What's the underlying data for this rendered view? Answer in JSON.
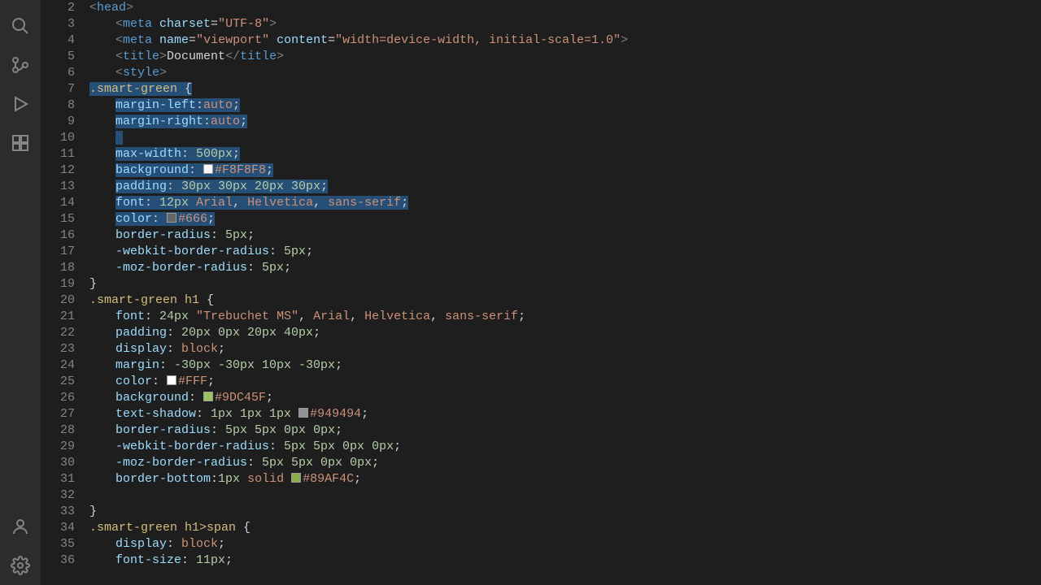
{
  "activity_icons": [
    "search",
    "source-control",
    "run-debug",
    "extensions",
    "account",
    "settings"
  ],
  "first_line_number": 2,
  "code_lines": [
    {
      "n": 2,
      "segs": [
        {
          "t": "<",
          "c": "c-angle"
        },
        {
          "t": "head",
          "c": "c-tag"
        },
        {
          "t": ">",
          "c": "c-angle"
        }
      ],
      "indent": 0
    },
    {
      "n": 3,
      "segs": [
        {
          "t": "<",
          "c": "c-angle"
        },
        {
          "t": "meta ",
          "c": "c-tag"
        },
        {
          "t": "charset",
          "c": "c-attr"
        },
        {
          "t": "=",
          "c": "c-punc"
        },
        {
          "t": "\"UTF-8\"",
          "c": "c-str"
        },
        {
          "t": ">",
          "c": "c-angle"
        }
      ],
      "indent": 2
    },
    {
      "n": 4,
      "segs": [
        {
          "t": "<",
          "c": "c-angle"
        },
        {
          "t": "meta ",
          "c": "c-tag"
        },
        {
          "t": "name",
          "c": "c-attr"
        },
        {
          "t": "=",
          "c": "c-punc"
        },
        {
          "t": "\"viewport\"",
          "c": "c-str"
        },
        {
          "t": " content",
          "c": "c-attr"
        },
        {
          "t": "=",
          "c": "c-punc"
        },
        {
          "t": "\"width=device-width, initial-scale=1.0\"",
          "c": "c-str"
        },
        {
          "t": ">",
          "c": "c-angle"
        }
      ],
      "indent": 2
    },
    {
      "n": 5,
      "segs": [
        {
          "t": "<",
          "c": "c-angle"
        },
        {
          "t": "title",
          "c": "c-tag"
        },
        {
          "t": ">",
          "c": "c-angle"
        },
        {
          "t": "Document",
          "c": "c-punc"
        },
        {
          "t": "</",
          "c": "c-angle"
        },
        {
          "t": "title",
          "c": "c-tag"
        },
        {
          "t": ">",
          "c": "c-angle"
        }
      ],
      "indent": 2
    },
    {
      "n": 6,
      "segs": [
        {
          "t": "<",
          "c": "c-angle"
        },
        {
          "t": "style",
          "c": "c-tag"
        },
        {
          "t": ">",
          "c": "c-angle"
        }
      ],
      "indent": 2
    },
    {
      "n": 7,
      "sel": true,
      "sel_from": 1,
      "segs": [
        {
          "t": ".smart-green",
          "c": "c-sel"
        },
        {
          "t": " {",
          "c": "c-punc"
        }
      ],
      "indent": 0
    },
    {
      "n": 8,
      "sel": true,
      "segs": [
        {
          "t": "margin-left",
          "c": "c-prop"
        },
        {
          "t": ":",
          "c": "c-punc"
        },
        {
          "t": "auto",
          "c": "c-kw"
        },
        {
          "t": ";",
          "c": "c-punc"
        }
      ],
      "indent": 2
    },
    {
      "n": 9,
      "sel": true,
      "segs": [
        {
          "t": "margin-right",
          "c": "c-prop"
        },
        {
          "t": ":",
          "c": "c-punc"
        },
        {
          "t": "auto",
          "c": "c-kw"
        },
        {
          "t": ";",
          "c": "c-punc"
        }
      ],
      "indent": 2
    },
    {
      "n": 10,
      "sel": true,
      "segs": [],
      "indent": 2
    },
    {
      "n": 11,
      "sel": true,
      "segs": [
        {
          "t": "max-width",
          "c": "c-prop"
        },
        {
          "t": ": ",
          "c": "c-punc"
        },
        {
          "t": "500px",
          "c": "c-num"
        },
        {
          "t": ";",
          "c": "c-punc"
        }
      ],
      "indent": 2
    },
    {
      "n": 12,
      "sel": true,
      "segs": [
        {
          "t": "background",
          "c": "c-prop"
        },
        {
          "t": ": ",
          "c": "c-punc"
        },
        {
          "sw": "#F8F8F8"
        },
        {
          "t": "#F8F8F8",
          "c": "c-val"
        },
        {
          "t": ";",
          "c": "c-punc"
        }
      ],
      "indent": 2
    },
    {
      "n": 13,
      "sel": true,
      "segs": [
        {
          "t": "padding",
          "c": "c-prop"
        },
        {
          "t": ": ",
          "c": "c-punc"
        },
        {
          "t": "30px 30px 20px 30px",
          "c": "c-num"
        },
        {
          "t": ";",
          "c": "c-punc"
        }
      ],
      "indent": 2
    },
    {
      "n": 14,
      "sel": true,
      "segs": [
        {
          "t": "font",
          "c": "c-prop"
        },
        {
          "t": ": ",
          "c": "c-punc"
        },
        {
          "t": "12px ",
          "c": "c-num"
        },
        {
          "t": "Arial",
          "c": "c-kw"
        },
        {
          "t": ", ",
          "c": "c-punc"
        },
        {
          "t": "Helvetica",
          "c": "c-kw"
        },
        {
          "t": ", ",
          "c": "c-punc"
        },
        {
          "t": "sans-serif",
          "c": "c-kw"
        },
        {
          "t": ";",
          "c": "c-punc"
        }
      ],
      "indent": 2
    },
    {
      "n": 15,
      "sel": true,
      "sel_to": 6,
      "segs": [
        {
          "t": "color",
          "c": "c-prop"
        },
        {
          "t": ": ",
          "c": "c-punc"
        },
        {
          "sw": "#666666"
        },
        {
          "t": "#666",
          "c": "c-val"
        },
        {
          "t": ";",
          "c": "c-punc"
        }
      ],
      "indent": 2
    },
    {
      "n": 16,
      "segs": [
        {
          "t": "border-radius",
          "c": "c-prop"
        },
        {
          "t": ": ",
          "c": "c-punc"
        },
        {
          "t": "5px",
          "c": "c-num"
        },
        {
          "t": ";",
          "c": "c-punc"
        }
      ],
      "indent": 2
    },
    {
      "n": 17,
      "segs": [
        {
          "t": "-webkit-border-radius",
          "c": "c-prop"
        },
        {
          "t": ": ",
          "c": "c-punc"
        },
        {
          "t": "5px",
          "c": "c-num"
        },
        {
          "t": ";",
          "c": "c-punc"
        }
      ],
      "indent": 2
    },
    {
      "n": 18,
      "segs": [
        {
          "t": "-moz-border-radius",
          "c": "c-prop"
        },
        {
          "t": ": ",
          "c": "c-punc"
        },
        {
          "t": "5px",
          "c": "c-num"
        },
        {
          "t": ";",
          "c": "c-punc"
        }
      ],
      "indent": 2
    },
    {
      "n": 19,
      "segs": [
        {
          "t": "}",
          "c": "c-punc"
        }
      ],
      "indent": 0
    },
    {
      "n": 20,
      "segs": [
        {
          "t": ".smart-green h1",
          "c": "c-sel"
        },
        {
          "t": " {",
          "c": "c-punc"
        }
      ],
      "indent": 0
    },
    {
      "n": 21,
      "segs": [
        {
          "t": "font",
          "c": "c-prop"
        },
        {
          "t": ": ",
          "c": "c-punc"
        },
        {
          "t": "24px ",
          "c": "c-num"
        },
        {
          "t": "\"Trebuchet MS\"",
          "c": "c-str"
        },
        {
          "t": ", ",
          "c": "c-punc"
        },
        {
          "t": "Arial",
          "c": "c-kw"
        },
        {
          "t": ", ",
          "c": "c-punc"
        },
        {
          "t": "Helvetica",
          "c": "c-kw"
        },
        {
          "t": ", ",
          "c": "c-punc"
        },
        {
          "t": "sans-serif",
          "c": "c-kw"
        },
        {
          "t": ";",
          "c": "c-punc"
        }
      ],
      "indent": 2
    },
    {
      "n": 22,
      "segs": [
        {
          "t": "padding",
          "c": "c-prop"
        },
        {
          "t": ": ",
          "c": "c-punc"
        },
        {
          "t": "20px 0px 20px 40px",
          "c": "c-num"
        },
        {
          "t": ";",
          "c": "c-punc"
        }
      ],
      "indent": 2
    },
    {
      "n": 23,
      "segs": [
        {
          "t": "display",
          "c": "c-prop"
        },
        {
          "t": ": ",
          "c": "c-punc"
        },
        {
          "t": "block",
          "c": "c-kw"
        },
        {
          "t": ";",
          "c": "c-punc"
        }
      ],
      "indent": 2
    },
    {
      "n": 24,
      "segs": [
        {
          "t": "margin",
          "c": "c-prop"
        },
        {
          "t": ": ",
          "c": "c-punc"
        },
        {
          "t": "-30px -30px 10px -30px",
          "c": "c-num"
        },
        {
          "t": ";",
          "c": "c-punc"
        }
      ],
      "indent": 2
    },
    {
      "n": 25,
      "segs": [
        {
          "t": "color",
          "c": "c-prop"
        },
        {
          "t": ": ",
          "c": "c-punc"
        },
        {
          "sw": "#FFFFFF"
        },
        {
          "t": "#FFF",
          "c": "c-val"
        },
        {
          "t": ";",
          "c": "c-punc"
        }
      ],
      "indent": 2
    },
    {
      "n": 26,
      "segs": [
        {
          "t": "background",
          "c": "c-prop"
        },
        {
          "t": ": ",
          "c": "c-punc"
        },
        {
          "sw": "#9DC45F"
        },
        {
          "t": "#9DC45F",
          "c": "c-val"
        },
        {
          "t": ";",
          "c": "c-punc"
        }
      ],
      "indent": 2
    },
    {
      "n": 27,
      "segs": [
        {
          "t": "text-shadow",
          "c": "c-prop"
        },
        {
          "t": ": ",
          "c": "c-punc"
        },
        {
          "t": "1px 1px 1px ",
          "c": "c-num"
        },
        {
          "sw": "#949494"
        },
        {
          "t": "#949494",
          "c": "c-val"
        },
        {
          "t": ";",
          "c": "c-punc"
        }
      ],
      "indent": 2
    },
    {
      "n": 28,
      "segs": [
        {
          "t": "border-radius",
          "c": "c-prop"
        },
        {
          "t": ": ",
          "c": "c-punc"
        },
        {
          "t": "5px 5px 0px 0px",
          "c": "c-num"
        },
        {
          "t": ";",
          "c": "c-punc"
        }
      ],
      "indent": 2
    },
    {
      "n": 29,
      "segs": [
        {
          "t": "-webkit-border-radius",
          "c": "c-prop"
        },
        {
          "t": ": ",
          "c": "c-punc"
        },
        {
          "t": "5px 5px 0px 0px",
          "c": "c-num"
        },
        {
          "t": ";",
          "c": "c-punc"
        }
      ],
      "indent": 2
    },
    {
      "n": 30,
      "segs": [
        {
          "t": "-moz-border-radius",
          "c": "c-prop"
        },
        {
          "t": ": ",
          "c": "c-punc"
        },
        {
          "t": "5px 5px 0px 0px",
          "c": "c-num"
        },
        {
          "t": ";",
          "c": "c-punc"
        }
      ],
      "indent": 2
    },
    {
      "n": 31,
      "segs": [
        {
          "t": "border-bottom",
          "c": "c-prop"
        },
        {
          "t": ":",
          "c": "c-punc"
        },
        {
          "t": "1px ",
          "c": "c-num"
        },
        {
          "t": "solid ",
          "c": "c-kw"
        },
        {
          "sw": "#89AF4C"
        },
        {
          "t": "#89AF4C",
          "c": "c-val"
        },
        {
          "t": ";",
          "c": "c-punc"
        }
      ],
      "indent": 2
    },
    {
      "n": 32,
      "segs": [],
      "indent": 0
    },
    {
      "n": 33,
      "segs": [
        {
          "t": "}",
          "c": "c-punc"
        }
      ],
      "indent": 0
    },
    {
      "n": 34,
      "segs": [
        {
          "t": ".smart-green h1>span",
          "c": "c-sel"
        },
        {
          "t": " {",
          "c": "c-punc"
        }
      ],
      "indent": 0
    },
    {
      "n": 35,
      "segs": [
        {
          "t": "display",
          "c": "c-prop"
        },
        {
          "t": ": ",
          "c": "c-punc"
        },
        {
          "t": "block",
          "c": "c-kw"
        },
        {
          "t": ";",
          "c": "c-punc"
        }
      ],
      "indent": 2
    },
    {
      "n": 36,
      "segs": [
        {
          "t": "font-size",
          "c": "c-prop"
        },
        {
          "t": ": ",
          "c": "c-punc"
        },
        {
          "t": "11px",
          "c": "c-num"
        },
        {
          "t": ";",
          "c": "c-punc"
        }
      ],
      "indent": 2
    }
  ]
}
